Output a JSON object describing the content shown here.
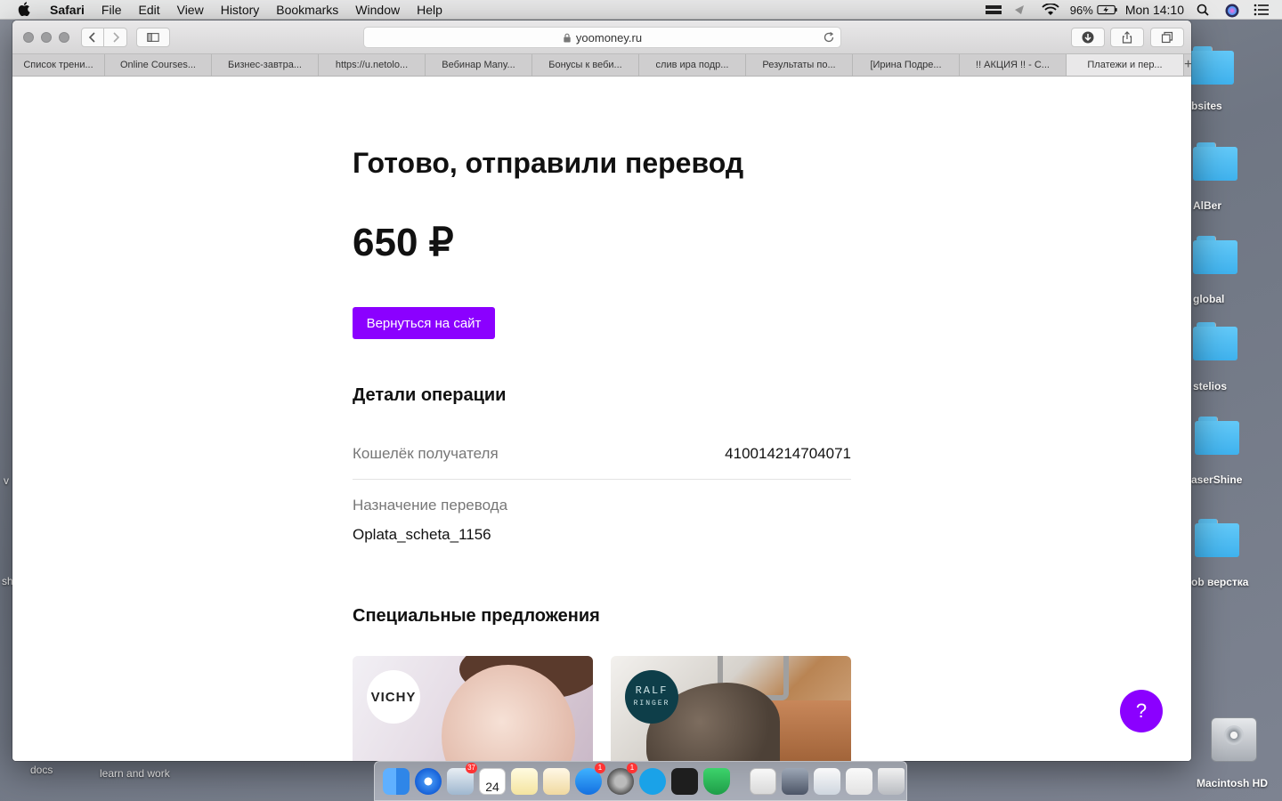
{
  "menubar": {
    "app_name": "Safari",
    "items": [
      "File",
      "Edit",
      "View",
      "History",
      "Bookmarks",
      "Window",
      "Help"
    ],
    "battery": "96%",
    "clock": "Mon 14:10"
  },
  "desktop": {
    "folders": [
      "bsites",
      "AlBer",
      "global",
      "stelios",
      "aserShine",
      "ob верстка"
    ],
    "bottom_labels": [
      "docs",
      "learn and work"
    ],
    "drive_label": "Macintosh HD",
    "left_edge_labels": [
      "v",
      "sh"
    ]
  },
  "browser": {
    "address": "yoomoney.ru",
    "tabs": [
      "Список трени...",
      "Online Courses...",
      "Бизнес-завтра...",
      "https://u.netolo...",
      "Вебинар Many...",
      "Бонусы к веби...",
      "слив ира подр...",
      "Результаты по...",
      "[Ирина Подре...",
      "!! АКЦИЯ !! - С...",
      "Платежи и пер..."
    ],
    "active_tab_index": 10,
    "new_tab_label": "+"
  },
  "page": {
    "title": "Готово, отправили перевод",
    "amount": "650 ₽",
    "back_button": "Вернуться на сайт",
    "details_heading": "Детали операции",
    "wallet_label": "Кошелёк получателя",
    "wallet_value": "410014214704071",
    "purpose_label": "Назначение перевода",
    "purpose_value": "Oplata_scheta_1156",
    "offers_heading": "Специальные предложения",
    "offers": [
      {
        "brand": "VICHY"
      },
      {
        "brand": "RALF",
        "brand_sub": "RINGER"
      }
    ],
    "help_button": "?",
    "accent_color": "#8b00ff"
  },
  "dock": {
    "badges": {
      "mail": "37",
      "appstore": "1",
      "settings": "1"
    },
    "calendar_day": "24"
  }
}
